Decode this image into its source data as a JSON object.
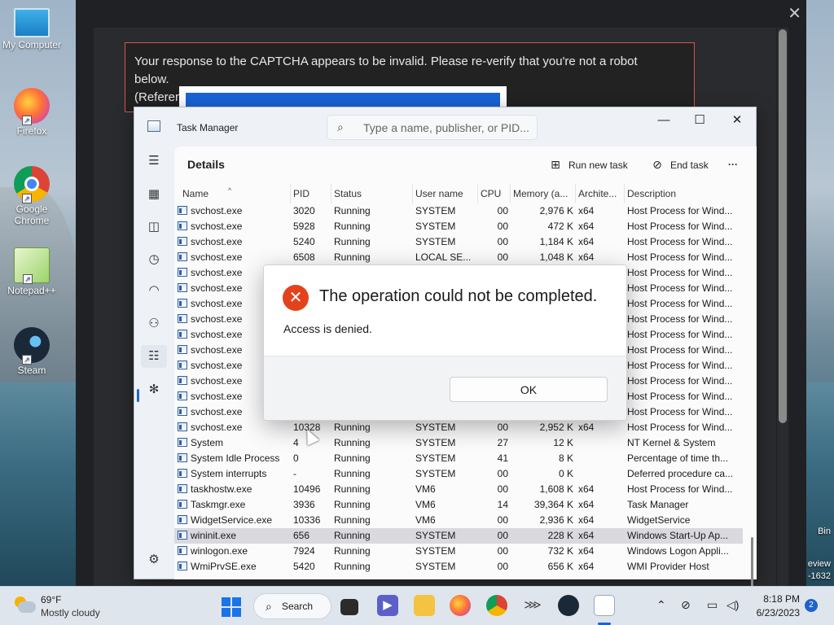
{
  "desktop": {
    "icons": [
      {
        "label": "My Computer"
      },
      {
        "label": "Firefox"
      },
      {
        "label": "Google Chrome"
      },
      {
        "label": "Notepad++"
      },
      {
        "label": "Steam"
      }
    ],
    "right_text": {
      "bin": "Bin",
      "review": "eview",
      "build": "-1632"
    }
  },
  "browser": {
    "captcha_line1": "Your response to the CAPTCHA appears to be invalid. Please re-verify that you're not a robot",
    "captcha_line2": "below.",
    "captcha_line3": "(Referen"
  },
  "task_manager": {
    "title": "Task Manager",
    "search_placeholder": "Type a name, publisher, or PID...",
    "section_title": "Details",
    "run_new_task": "Run new task",
    "end_task": "End task",
    "more": "···",
    "columns": [
      "Name",
      "PID",
      "Status",
      "User name",
      "CPU",
      "Memory (a...",
      "Archite...",
      "Description"
    ],
    "rows": [
      [
        "svchost.exe",
        "3020",
        "Running",
        "SYSTEM",
        "00",
        "2,976 K",
        "x64",
        "Host Process for Wind..."
      ],
      [
        "svchost.exe",
        "5928",
        "Running",
        "SYSTEM",
        "00",
        "472 K",
        "x64",
        "Host Process for Wind..."
      ],
      [
        "svchost.exe",
        "5240",
        "Running",
        "SYSTEM",
        "00",
        "1,184 K",
        "x64",
        "Host Process for Wind..."
      ],
      [
        "svchost.exe",
        "6508",
        "Running",
        "LOCAL SE...",
        "00",
        "1,048 K",
        "x64",
        "Host Process for Wind..."
      ],
      [
        "svchost.exe",
        "",
        "",
        "",
        "",
        "",
        "",
        "Host Process for Wind..."
      ],
      [
        "svchost.exe",
        "",
        "",
        "",
        "",
        "",
        "",
        "Host Process for Wind..."
      ],
      [
        "svchost.exe",
        "",
        "",
        "",
        "",
        "",
        "",
        "Host Process for Wind..."
      ],
      [
        "svchost.exe",
        "",
        "",
        "",
        "",
        "",
        "",
        "Host Process for Wind..."
      ],
      [
        "svchost.exe",
        "",
        "",
        "",
        "",
        "",
        "",
        "Host Process for Wind..."
      ],
      [
        "svchost.exe",
        "",
        "",
        "",
        "",
        "",
        "",
        "Host Process for Wind..."
      ],
      [
        "svchost.exe",
        "",
        "",
        "",
        "",
        "",
        "",
        "Host Process for Wind..."
      ],
      [
        "svchost.exe",
        "",
        "",
        "",
        "",
        "",
        "",
        "Host Process for Wind..."
      ],
      [
        "svchost.exe",
        "",
        "",
        "",
        "",
        "",
        "",
        "Host Process for Wind..."
      ],
      [
        "svchost.exe",
        "",
        "",
        "",
        "",
        "",
        "",
        "Host Process for Wind..."
      ],
      [
        "svchost.exe",
        "10328",
        "Running",
        "SYSTEM",
        "00",
        "2,952 K",
        "x64",
        "Host Process for Wind..."
      ],
      [
        "System",
        "4",
        "Running",
        "SYSTEM",
        "27",
        "12 K",
        "",
        "NT Kernel & System"
      ],
      [
        "System Idle Process",
        "0",
        "Running",
        "SYSTEM",
        "41",
        "8 K",
        "",
        "Percentage of time th..."
      ],
      [
        "System interrupts",
        "-",
        "Running",
        "SYSTEM",
        "00",
        "0 K",
        "",
        "Deferred procedure ca..."
      ],
      [
        "taskhostw.exe",
        "10496",
        "Running",
        "VM6",
        "00",
        "1,608 K",
        "x64",
        "Host Process for Wind..."
      ],
      [
        "Taskmgr.exe",
        "3936",
        "Running",
        "VM6",
        "14",
        "39,364 K",
        "x64",
        "Task Manager"
      ],
      [
        "WidgetService.exe",
        "10336",
        "Running",
        "VM6",
        "00",
        "2,936 K",
        "x64",
        "WidgetService"
      ],
      [
        "wininit.exe",
        "656",
        "Running",
        "SYSTEM",
        "00",
        "228 K",
        "x64",
        "Windows Start-Up Ap..."
      ],
      [
        "winlogon.exe",
        "7924",
        "Running",
        "SYSTEM",
        "00",
        "732 K",
        "x64",
        "Windows Logon Appli..."
      ],
      [
        "WmiPrvSE.exe",
        "5420",
        "Running",
        "SYSTEM",
        "00",
        "656 K",
        "x64",
        "WMI Provider Host"
      ]
    ],
    "selected_row": 21
  },
  "dialog": {
    "title": "The operation could not be completed.",
    "message": "Access is denied.",
    "ok": "OK"
  },
  "taskbar": {
    "temp": "69°F",
    "weather": "Mostly cloudy",
    "search": "Search",
    "time": "8:18 PM",
    "date": "6/23/2023",
    "notifications": "2"
  },
  "colors": {
    "accent": "#1f63c8",
    "error": "#e2431d",
    "captcha_border": "#d9534f"
  }
}
